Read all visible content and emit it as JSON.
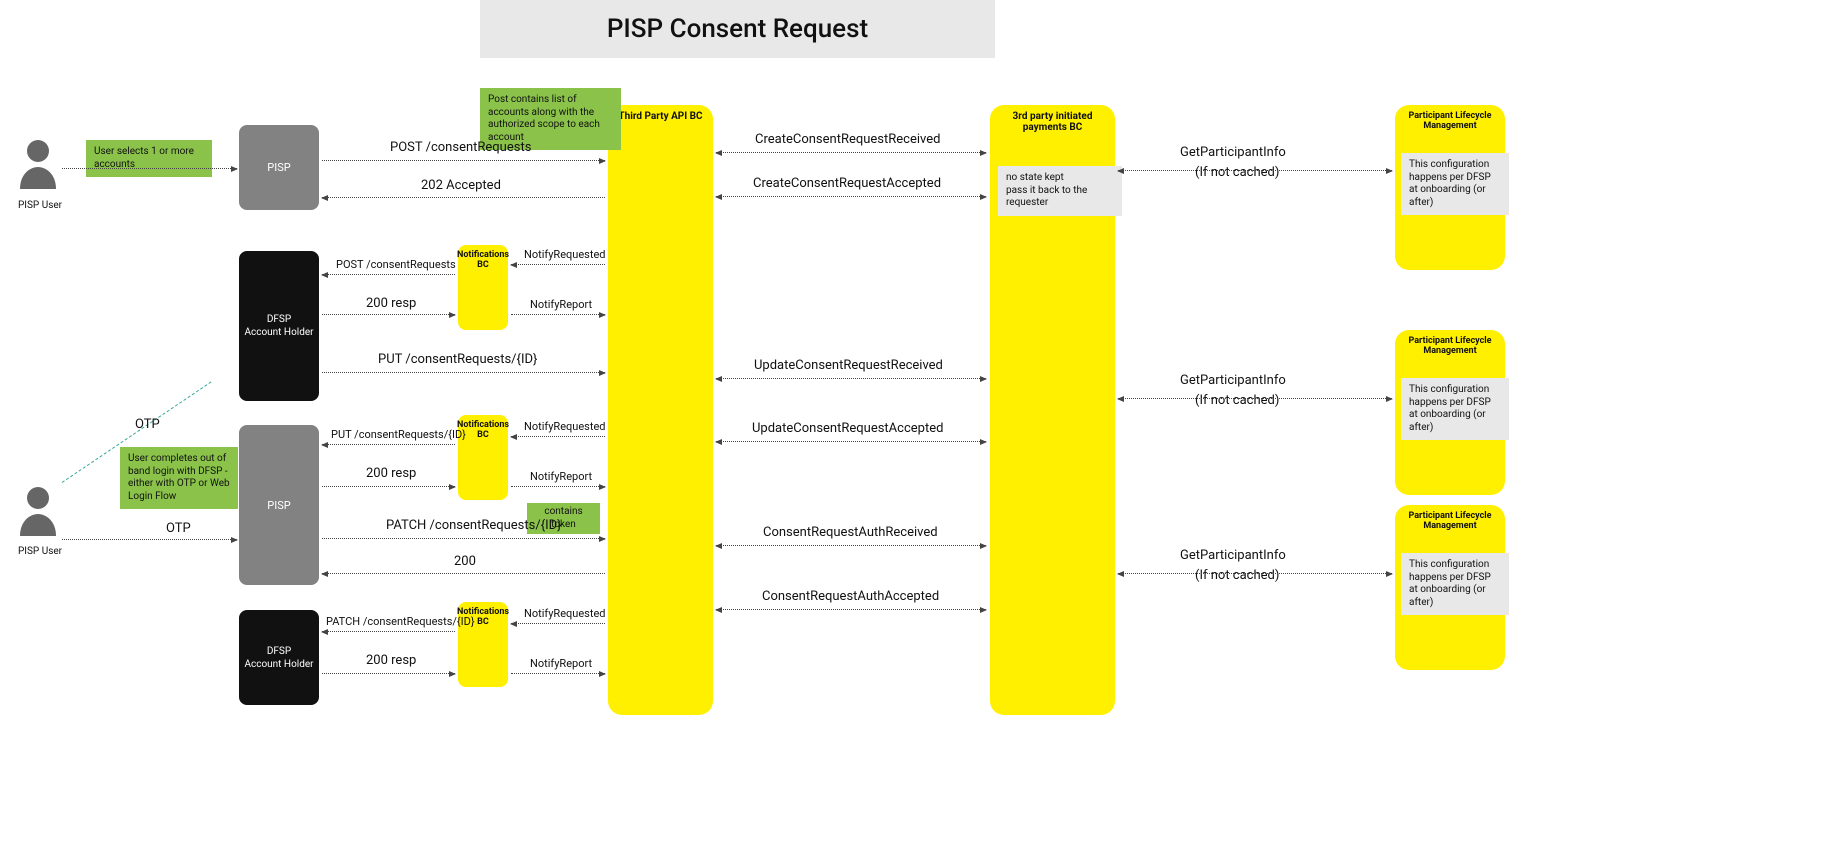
{
  "title": "PISP Consent Request",
  "actors": {
    "pispUser": "PISP User"
  },
  "lanes": {
    "tpApi": "Third Party API BC",
    "tpip": "3rd party initiated payments BC",
    "plm": "Participant Lifecycle Management",
    "notif": "Notifications BC"
  },
  "boxes": {
    "pisp": "PISP",
    "dfsp": "DFSP\nAccount Holder"
  },
  "notes": {
    "selectAccounts": "User selects 1 or more accounts",
    "postContains": "Post contains list of accounts along with the authorized scope to each account",
    "noState": "no state kept\npass it back to the requester",
    "config": "This configuration happens per DFSP at onboarding (or after)",
    "outOfBand": "User completes out of band login with DFSP - either with OTP or Web Login Flow",
    "containsToken": "contains token"
  },
  "otp": "OTP",
  "msgs": {
    "postConsent": "POST /consentRequests",
    "accepted202": "202 Accepted",
    "createReceived": "CreateConsentRequestReceived",
    "createAccepted": "CreateConsentRequestAccepted",
    "getParticipant": "GetParticipantInfo",
    "ifNotCached": "(If not cached)",
    "notifyRequested": "NotifyRequested",
    "notifyReport": "NotifyReport",
    "resp200": "200 resp",
    "putConsent": "PUT /consentRequests/{ID}",
    "updateReceived": "UpdateConsentRequestReceived",
    "updateAccepted": "UpdateConsentRequestAccepted",
    "patchConsent": "PATCH /consentRequests/{ID}",
    "twoHundred": "200",
    "authReceived": "ConsentRequestAuthReceived",
    "authAccepted": "ConsentRequestAuthAccepted"
  }
}
